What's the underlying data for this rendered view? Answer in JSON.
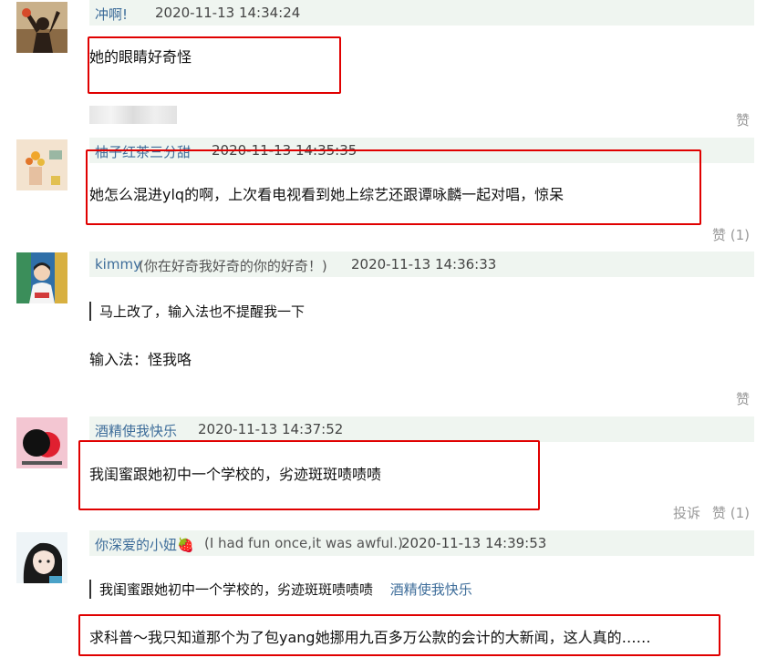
{
  "comments": [
    {
      "username": "冲啊!",
      "time": "2020-11-13 14:34:24",
      "text": "她的眼睛好奇怪",
      "like_label": "赞"
    },
    {
      "username": "柚子红茶三分甜",
      "time": "2020-11-13 14:35:35",
      "text": "她怎么混进ylq的啊，上次看电视看到她上综艺还跟谭咏麟一起对唱，惊呆",
      "like_label": "赞 (1)"
    },
    {
      "username": "kimmy",
      "signature": "(你在好奇我好奇的你的好奇！)",
      "time": "2020-11-13 14:36:33",
      "quote": "马上改了，输入法也不提醒我一下",
      "text": "输入法：怪我咯",
      "like_label": "赞"
    },
    {
      "username": "酒精使我快乐",
      "time": "2020-11-13 14:37:52",
      "text": "我闺蜜跟她初中一个学校的，劣迹斑斑啧啧啧",
      "report_label": "投诉",
      "like_label": "赞 (1)"
    },
    {
      "username": "你深爱的小妞🍓",
      "signature": "(I had fun once,it was awful.)",
      "time": "2020-11-13 14:39:53",
      "quote": "我闺蜜跟她初中一个学校的，劣迹斑斑啧啧啧",
      "quote_author": "酒精使我快乐",
      "text": "求科普～我只知道那个为了包yang她挪用九百多万公款的会计的大新闻，这人真的……"
    }
  ],
  "colors": {
    "highlight_box": "#e00000",
    "header_bg": "#eff5f0",
    "username": "#3e6d9a",
    "action": "#999999"
  }
}
